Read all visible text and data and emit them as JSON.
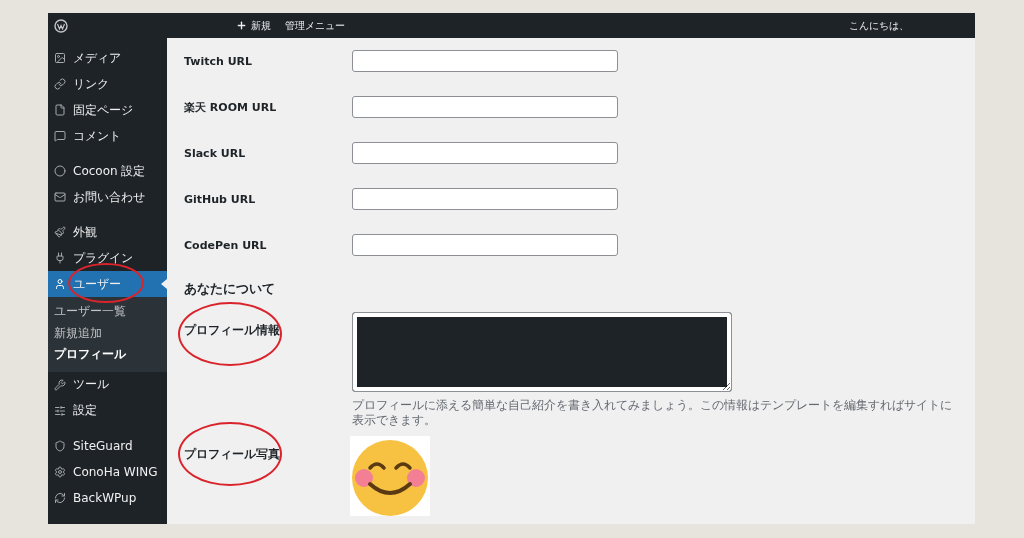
{
  "admin_bar": {
    "new_label": "新規",
    "menu_label": "管理メニュー",
    "greeting": "こんにちは、"
  },
  "sidebar": {
    "groups": [
      [
        {
          "label": "メディア",
          "selected": false,
          "circled": false
        },
        {
          "label": "リンク",
          "selected": false,
          "circled": false
        },
        {
          "label": "固定ページ",
          "selected": false,
          "circled": false
        },
        {
          "label": "コメント",
          "selected": false,
          "circled": false
        }
      ],
      [
        {
          "label": "Cocoon 設定",
          "selected": false,
          "circled": false
        },
        {
          "label": "お問い合わせ",
          "selected": false,
          "circled": false
        }
      ],
      [
        {
          "label": "外観",
          "selected": false,
          "circled": false
        },
        {
          "label": "プラグイン",
          "selected": false,
          "circled": false
        },
        {
          "label": "ユーザー",
          "selected": true,
          "circled": true,
          "children": [
            {
              "label": "ユーザー一覧",
              "selected": false
            },
            {
              "label": "新規追加",
              "selected": false
            },
            {
              "label": "プロフィール",
              "selected": true
            }
          ]
        },
        {
          "label": "ツール",
          "selected": false,
          "circled": false
        },
        {
          "label": "設定",
          "selected": false,
          "circled": false
        }
      ],
      [
        {
          "label": "SiteGuard",
          "selected": false,
          "circled": false
        },
        {
          "label": "ConoHa WING",
          "selected": false,
          "circled": false
        },
        {
          "label": "BackWPup",
          "selected": false,
          "circled": false
        }
      ]
    ]
  },
  "url_fields": [
    {
      "label": "Twitch URL"
    },
    {
      "label": "楽天 ROOM URL"
    },
    {
      "label": "Slack URL"
    },
    {
      "label": "GitHub URL"
    },
    {
      "label": "CodePen URL"
    }
  ],
  "about": {
    "heading": "あなたについて",
    "bio": {
      "label": "プロフィール情報",
      "circled": true,
      "description": "プロフィールに添える簡単な自己紹介を書き入れてみましょう。この情報はテンプレートを編集すればサイトに表示できます。"
    },
    "photo": {
      "label": "プロフィール写真",
      "circled": true
    }
  }
}
